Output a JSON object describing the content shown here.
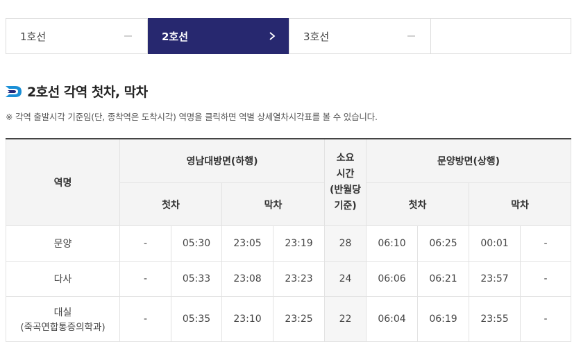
{
  "tabs": [
    {
      "label": "1호선"
    },
    {
      "label": "2호선"
    },
    {
      "label": "3호선"
    },
    {
      "label": ""
    }
  ],
  "heading": {
    "title": "2호선 각역 첫차, 막차",
    "notice": "※ 각역 출발시각 기준임(단, 종착역은 도착시각) 역명을 클릭하면 역별 상세열차시각표를 볼 수 있습니다."
  },
  "table": {
    "col_station": "역명",
    "dir_down": "영남대방면(하행)",
    "duration_lines": [
      "소요",
      "시간",
      "(반월당",
      "기준)"
    ],
    "dir_up": "문양방면(상행)",
    "first": "첫차",
    "last": "막차",
    "rows": [
      {
        "station": "문양",
        "sub": "",
        "cells": [
          "-",
          "05:30",
          "23:05",
          "23:19",
          "28",
          "06:10",
          "06:25",
          "00:01",
          "-"
        ]
      },
      {
        "station": "다사",
        "sub": "",
        "cells": [
          "-",
          "05:33",
          "23:08",
          "23:23",
          "24",
          "06:06",
          "06:21",
          "23:57",
          "-"
        ]
      },
      {
        "station": "대실",
        "sub": "(죽곡연합통증의학과)",
        "cells": [
          "-",
          "05:35",
          "23:10",
          "23:25",
          "22",
          "06:04",
          "06:19",
          "23:55",
          "-"
        ]
      }
    ]
  },
  "colors": {
    "active_tab": "#27286f",
    "logo_blue": "#1a8fd6"
  }
}
